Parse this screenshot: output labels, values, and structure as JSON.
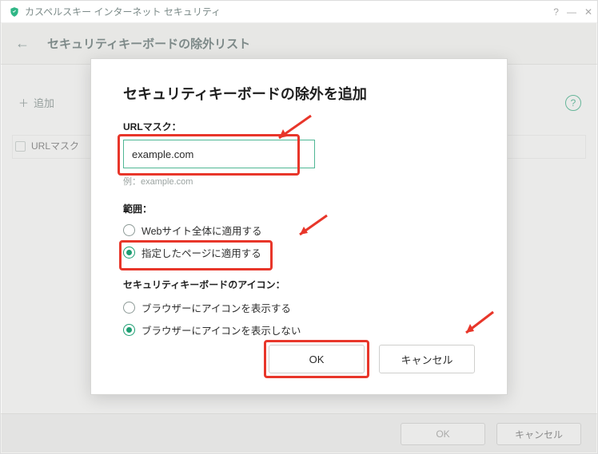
{
  "titlebar": {
    "app_name": "カスペルスキー インターネット セキュリティ"
  },
  "page": {
    "title": "セキュリティキーボードの除外リスト",
    "add_button": "追加",
    "column_url_mask": "URLマスク",
    "footer_ok": "OK",
    "footer_cancel": "キャンセル"
  },
  "modal": {
    "title": "セキュリティキーボードの除外を追加",
    "url_label": "URLマスク：",
    "url_value": "example.com",
    "url_hint": "例：example.com",
    "scope_label": "範囲：",
    "scope_site": "Webサイト全体に適用する",
    "scope_page": "指定したページに適用する",
    "icon_label": "セキュリティキーボードのアイコン：",
    "icon_show": "ブラウザーにアイコンを表示する",
    "icon_hide": "ブラウザーにアイコンを表示しない",
    "ok": "OK",
    "cancel": "キャンセル"
  },
  "colors": {
    "accent": "#1d9e72",
    "highlight": "#e8362a"
  }
}
